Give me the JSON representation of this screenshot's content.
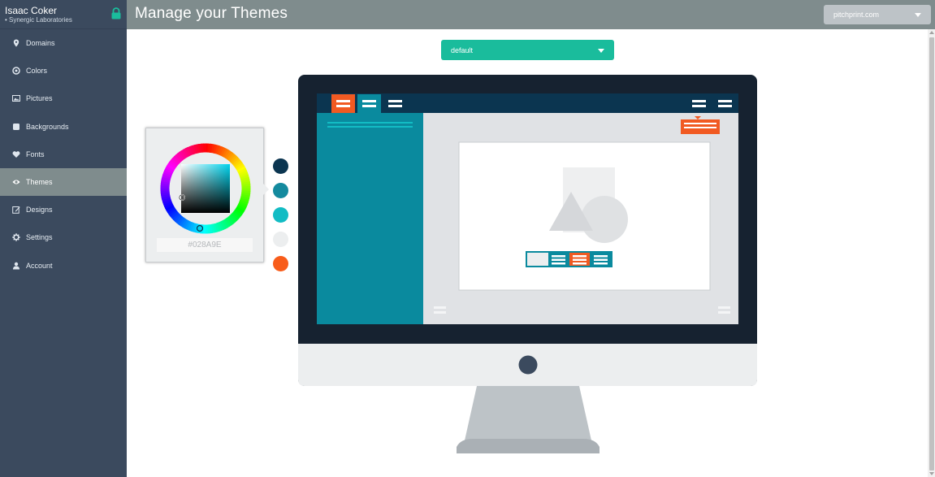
{
  "user": {
    "name": "Isaac Coker",
    "org": "• Synergic Laboratories"
  },
  "nav": {
    "items": [
      {
        "label": "Domains",
        "icon": "map-marker-icon"
      },
      {
        "label": "Colors",
        "icon": "target-icon"
      },
      {
        "label": "Pictures",
        "icon": "picture-icon"
      },
      {
        "label": "Backgrounds",
        "icon": "square-icon"
      },
      {
        "label": "Fonts",
        "icon": "heart-icon"
      },
      {
        "label": "Themes",
        "icon": "eye-icon",
        "active": true
      },
      {
        "label": "Designs",
        "icon": "edit-icon"
      },
      {
        "label": "Settings",
        "icon": "gear-icon"
      },
      {
        "label": "Account",
        "icon": "user-icon"
      }
    ]
  },
  "header": {
    "title": "Manage your Themes",
    "site": "pitchprint.com"
  },
  "theme_select": {
    "value": "default"
  },
  "picker": {
    "hex": "#028A9E"
  },
  "swatches": [
    "#0b3550",
    "#148a9e",
    "#12bcc4",
    "#eceeef",
    "#f85c1a"
  ],
  "colors": {
    "accent": "#1abc9c",
    "sidebar": "#3b4a5e",
    "header": "#7f8c8d",
    "orange": "#f15a22",
    "teal": "#0a8a9e",
    "navy": "#0b3550"
  }
}
